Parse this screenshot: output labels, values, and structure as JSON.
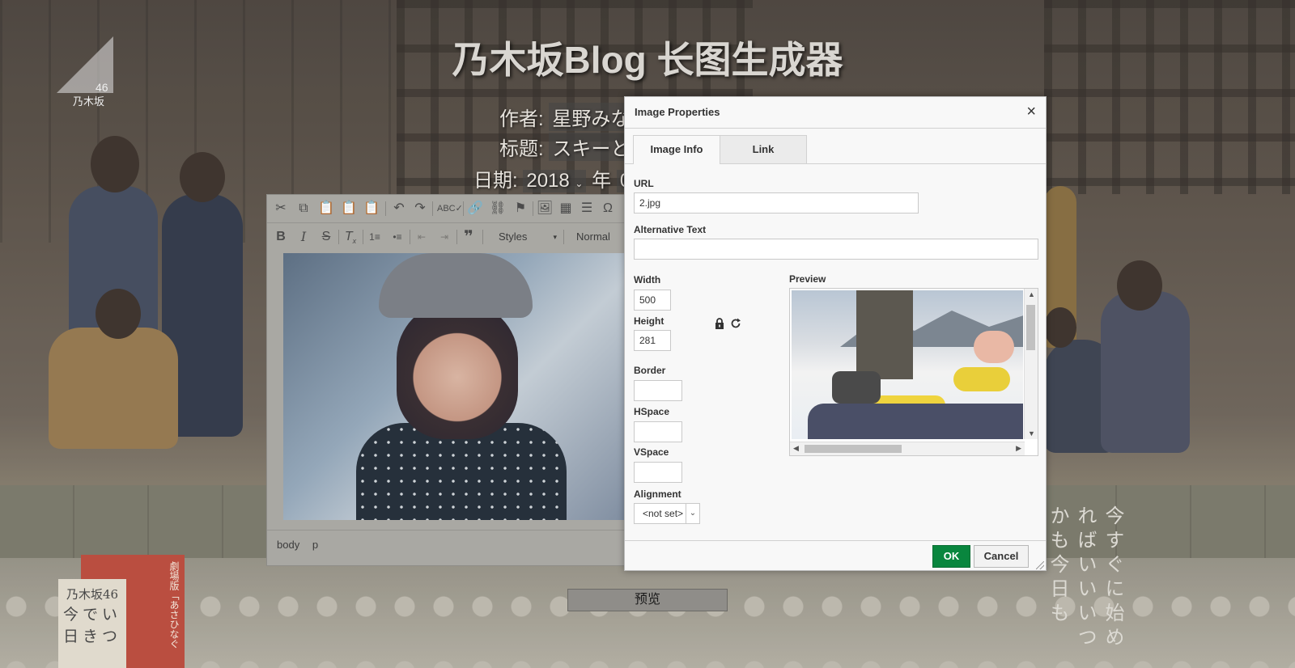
{
  "page": {
    "title": "乃木坂Blog 长图生成器",
    "author_label": "作者:",
    "author_value": "星野みな",
    "title_label": "标题:",
    "title_value": "スキーと",
    "date_label": "日期:",
    "date_year": "2018",
    "date_year_unit": "年",
    "date_month_partial": "0",
    "preview_button": "预览"
  },
  "background": {
    "logo_number": "46",
    "logo_text": "乃木坂",
    "poster_top": "乃木坂46",
    "poster_lines": [
      "今でい",
      "日きつ"
    ],
    "poster_side": "劇場版「あさひなぐ",
    "vertical_text": "今すぐに始めればいいいつかも今日も"
  },
  "editor": {
    "styles_label": "Styles",
    "format_label": "Normal",
    "status_path": [
      "body",
      "p"
    ]
  },
  "dialog": {
    "title": "Image Properties",
    "tabs": [
      {
        "label": "Image Info",
        "active": true
      },
      {
        "label": "Link",
        "active": false
      }
    ],
    "url_label": "URL",
    "url_value": "2.jpg",
    "alt_label": "Alternative Text",
    "alt_value": "",
    "width_label": "Width",
    "width_value": "500",
    "height_label": "Height",
    "height_value": "281",
    "border_label": "Border",
    "border_value": "",
    "hspace_label": "HSpace",
    "hspace_value": "",
    "vspace_label": "VSpace",
    "vspace_value": "",
    "alignment_label": "Alignment",
    "alignment_value": "<not set>",
    "preview_label": "Preview",
    "ok_label": "OK",
    "cancel_label": "Cancel"
  },
  "colors": {
    "ok_button": "#09863e",
    "dialog_bg": "#f8f8f8"
  }
}
